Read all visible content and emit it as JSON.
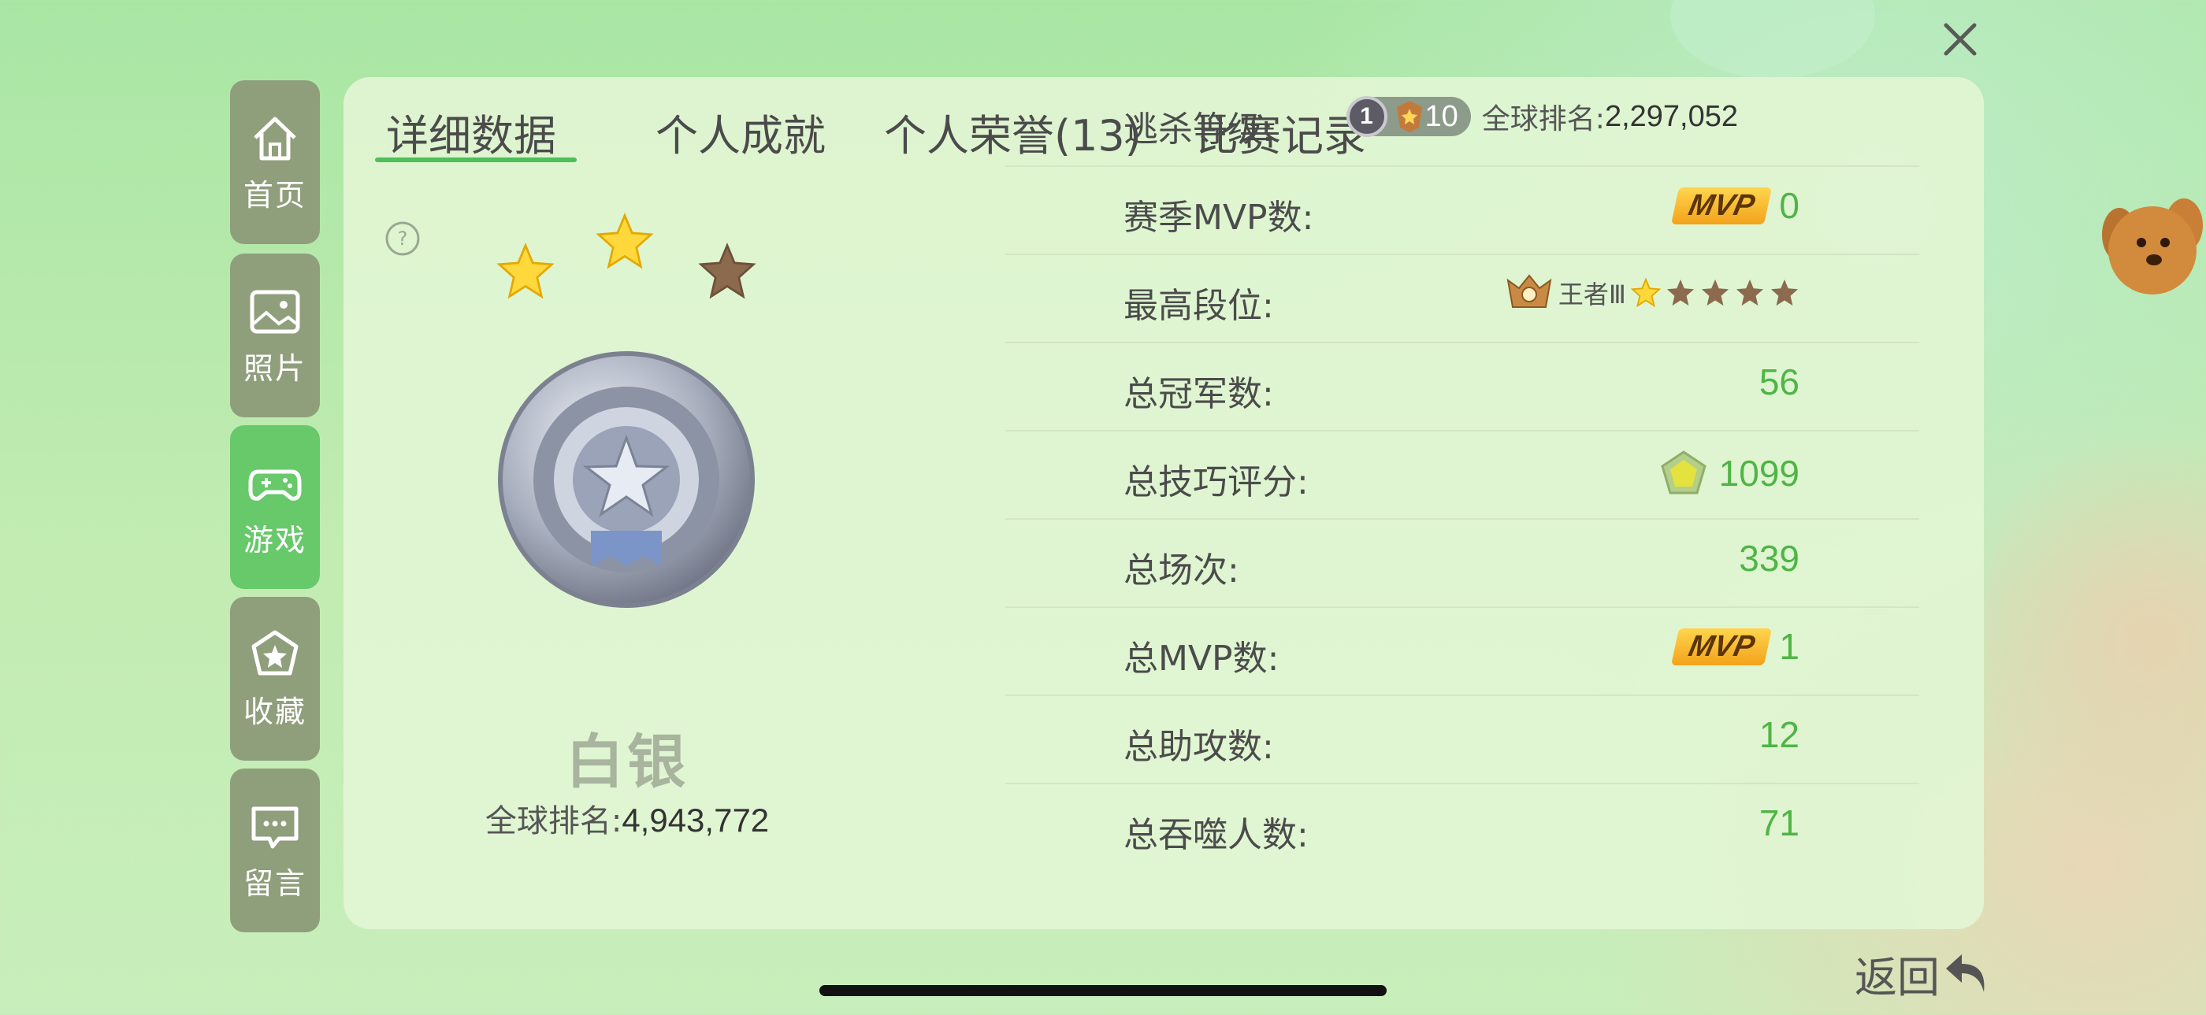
{
  "sidebar": {
    "items": [
      {
        "label": "首页",
        "icon": "home-icon"
      },
      {
        "label": "照片",
        "icon": "photo-icon"
      },
      {
        "label": "游戏",
        "icon": "gamepad-icon"
      },
      {
        "label": "收藏",
        "icon": "star-shield-icon"
      },
      {
        "label": "留言",
        "icon": "message-icon"
      }
    ],
    "active": "游戏"
  },
  "tabs": [
    {
      "label": "详细数据"
    },
    {
      "label": "个人成就"
    },
    {
      "label": "个人荣誉(13)"
    },
    {
      "label": "比赛记录"
    }
  ],
  "rank": {
    "name": "白银",
    "global_label": "全球排名:",
    "global_value": "4,943,772",
    "stars_lit": 2,
    "stars_total": 3
  },
  "stats": {
    "escape_level": {
      "label": "逃杀等级:",
      "level_badge": "1",
      "level": "10",
      "global_label": "全球排名:",
      "global_value": "2,297,052"
    },
    "season_mvp": {
      "label": "赛季MVP数:",
      "badge": "MVP",
      "value": "0"
    },
    "highest_tier": {
      "label": "最高段位:",
      "tier": "王者Ⅲ",
      "stars_lit": 1,
      "stars_total": 5
    },
    "championships": {
      "label": "总冠军数:",
      "value": "56"
    },
    "skill_score": {
      "label": "总技巧评分:",
      "value": "1099"
    },
    "total_matches": {
      "label": "总场次:",
      "value": "339"
    },
    "total_mvp": {
      "label": "总MVP数:",
      "badge": "MVP",
      "value": "1"
    },
    "assists": {
      "label": "总助攻数:",
      "value": "12"
    },
    "devoured": {
      "label": "总吞噬人数:",
      "value": "71"
    }
  },
  "back": {
    "label": "返回"
  },
  "colors": {
    "accent": "#4fb545",
    "sidebar": "#8f9e7b",
    "sidebar_active": "#67c96a"
  }
}
